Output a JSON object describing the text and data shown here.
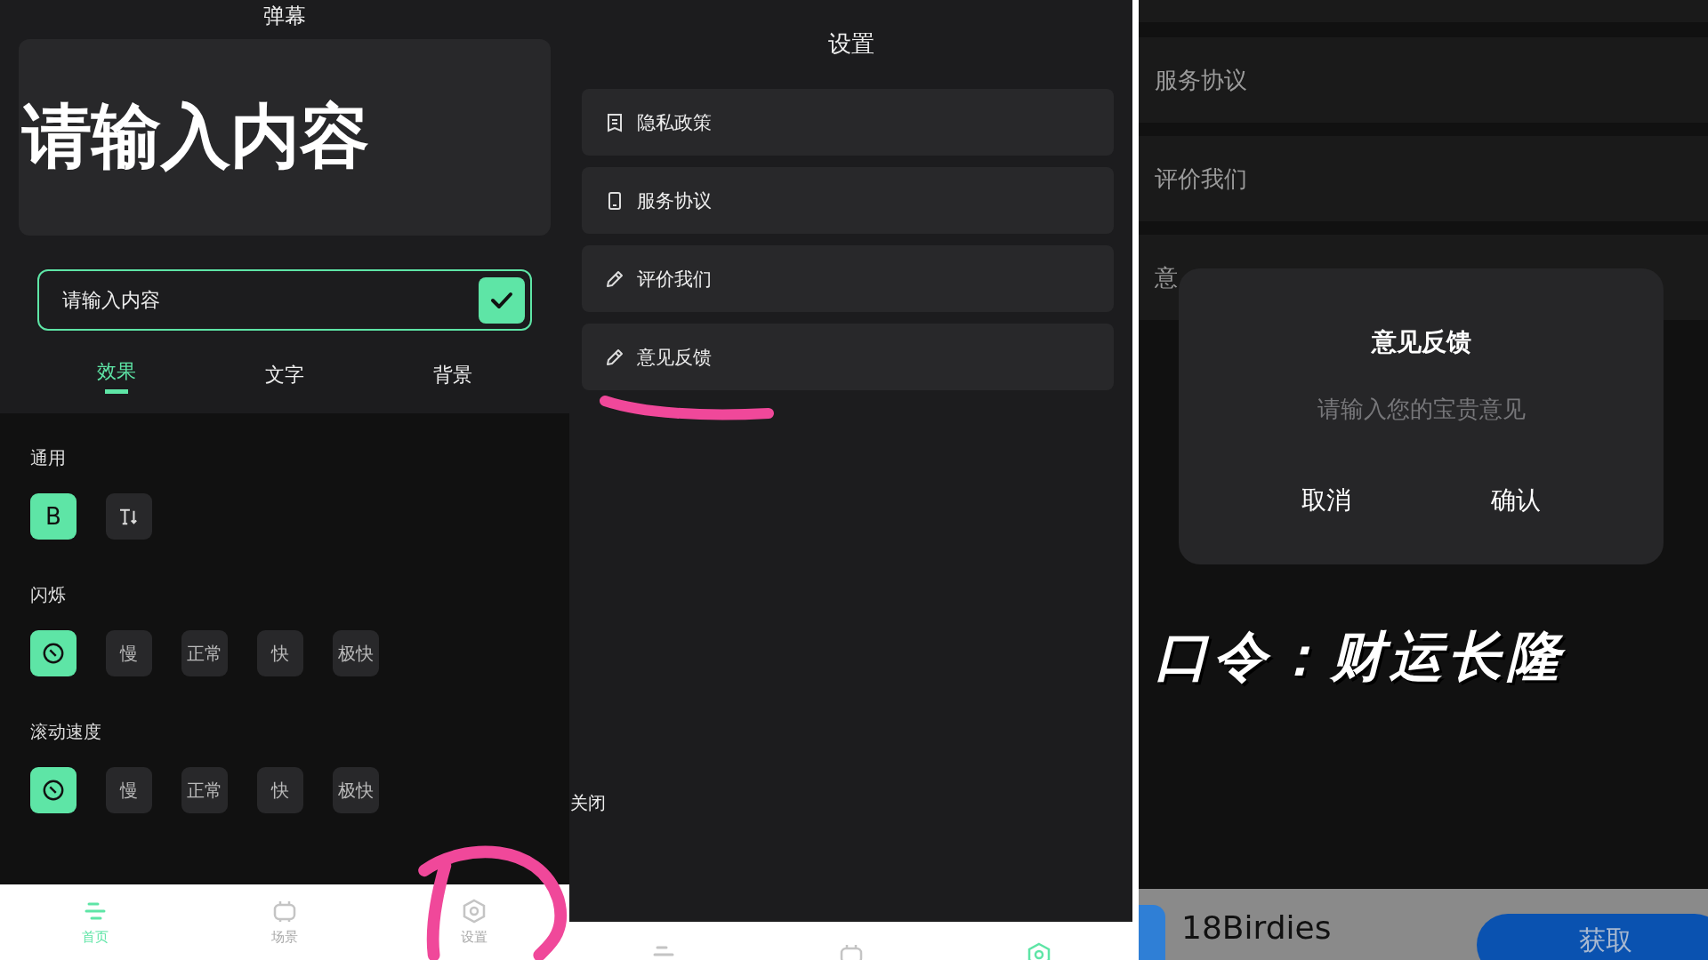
{
  "editor": {
    "title": "弹幕",
    "preview_text": "请输入内容",
    "input": {
      "value": "请输入内容"
    },
    "tabs": [
      {
        "label": "效果",
        "selected": true
      },
      {
        "label": "文字",
        "selected": false
      },
      {
        "label": "背景",
        "selected": false
      }
    ],
    "sections": [
      {
        "title": "通用",
        "options": [
          {
            "kind": "label",
            "label": "B",
            "selected": true
          },
          {
            "kind": "text-direction",
            "selected": false
          }
        ]
      },
      {
        "title": "闪烁",
        "options": [
          {
            "kind": "off",
            "selected": true
          },
          {
            "kind": "label",
            "label": "慢",
            "selected": false
          },
          {
            "kind": "label",
            "label": "正常",
            "selected": false
          },
          {
            "kind": "label",
            "label": "快",
            "selected": false
          },
          {
            "kind": "label",
            "label": "极快",
            "selected": false
          }
        ]
      },
      {
        "title": "滚动速度",
        "options": [
          {
            "kind": "off",
            "selected": true
          },
          {
            "kind": "label",
            "label": "慢",
            "selected": false
          },
          {
            "kind": "label",
            "label": "正常",
            "selected": false
          },
          {
            "kind": "label",
            "label": "快",
            "selected": false
          },
          {
            "kind": "label",
            "label": "极快",
            "selected": false
          }
        ]
      }
    ],
    "nav": [
      {
        "kind": "lines",
        "label": "首页",
        "selected": true
      },
      {
        "kind": "tv",
        "label": "场景",
        "selected": false
      },
      {
        "kind": "gear",
        "label": "设置",
        "selected": false
      }
    ]
  },
  "settings": {
    "title": "设置",
    "items": [
      {
        "kind": "document",
        "label": "隐私政策"
      },
      {
        "kind": "phone",
        "label": "服务协议"
      },
      {
        "kind": "pencil",
        "label": "评价我们"
      },
      {
        "kind": "pencil",
        "label": "意见反馈"
      }
    ],
    "close_label": "关闭",
    "nav": [
      {
        "kind": "lines",
        "selected": false
      },
      {
        "kind": "tv",
        "selected": false
      },
      {
        "kind": "gear",
        "selected": true
      }
    ]
  },
  "feedback_screen": {
    "items": [
      "服务协议",
      "评价我们",
      "意"
    ],
    "dialog": {
      "title": "意见反馈",
      "placeholder": "请输入您的宝贵意见",
      "buttons": [
        "取消",
        "确认"
      ]
    },
    "caption": "口令：财运长隆",
    "ad": {
      "app_name": "18Birdies",
      "button": "获取"
    }
  }
}
